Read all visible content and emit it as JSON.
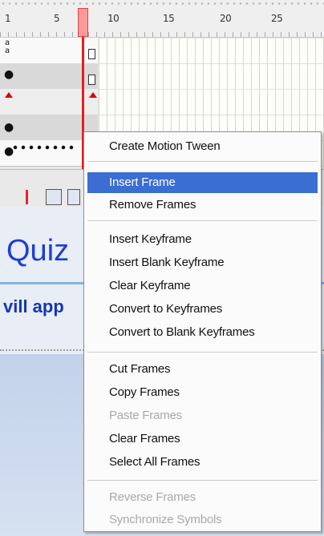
{
  "timeline": {
    "ruler_labels": [
      "1",
      "5",
      "10",
      "15",
      "20",
      "25"
    ]
  },
  "stage": {
    "title": "Quiz",
    "subtitle": "vill app"
  },
  "context_menu": {
    "items": [
      {
        "label": "Create Motion Tween",
        "state": "normal"
      },
      {
        "label": "Insert Frame",
        "state": "highlighted"
      },
      {
        "label": "Remove Frames",
        "state": "normal"
      },
      {
        "label": "Insert Keyframe",
        "state": "normal"
      },
      {
        "label": "Insert Blank Keyframe",
        "state": "normal"
      },
      {
        "label": "Clear Keyframe",
        "state": "normal"
      },
      {
        "label": "Convert to Keyframes",
        "state": "normal"
      },
      {
        "label": "Convert to Blank Keyframes",
        "state": "normal"
      },
      {
        "label": "Cut Frames",
        "state": "normal"
      },
      {
        "label": "Copy Frames",
        "state": "normal"
      },
      {
        "label": "Paste Frames",
        "state": "disabled"
      },
      {
        "label": "Clear Frames",
        "state": "normal"
      },
      {
        "label": "Select All Frames",
        "state": "normal"
      },
      {
        "label": "Reverse Frames",
        "state": "disabled"
      },
      {
        "label": "Synchronize Symbols",
        "state": "disabled"
      }
    ]
  },
  "colors": {
    "menu_highlight": "#3a6ed2",
    "playhead": "#e61d1d",
    "stage_title": "#1b3fd6"
  }
}
